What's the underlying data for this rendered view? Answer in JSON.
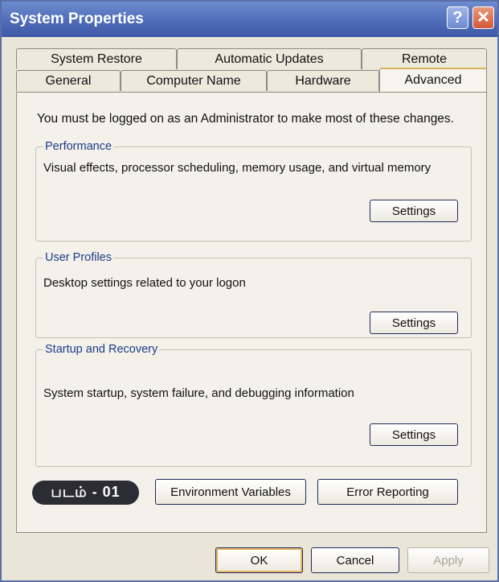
{
  "window": {
    "title": "System Properties"
  },
  "title_buttons": {
    "help": "?",
    "close": "✕"
  },
  "tabs_back": [
    "System Restore",
    "Automatic Updates",
    "Remote"
  ],
  "tabs_front": [
    "General",
    "Computer Name",
    "Hardware",
    "Advanced"
  ],
  "active_tab": "Advanced",
  "notice": "You must be logged on as an Administrator to make most of these changes.",
  "performance": {
    "title": "Performance",
    "description": "Visual effects, processor scheduling, memory usage, and virtual memory",
    "button": "Settings"
  },
  "user_profiles": {
    "title": "User Profiles",
    "description": "Desktop settings related to your logon",
    "button": "Settings"
  },
  "startup_recovery": {
    "title": "Startup and Recovery",
    "description": "System startup, system failure, and debugging information",
    "button": "Settings"
  },
  "badge": "படம் - 01",
  "environment_button": "Environment Variables",
  "error_button": "Error Reporting",
  "footer": {
    "ok": "OK",
    "cancel": "Cancel",
    "apply": "Apply"
  }
}
